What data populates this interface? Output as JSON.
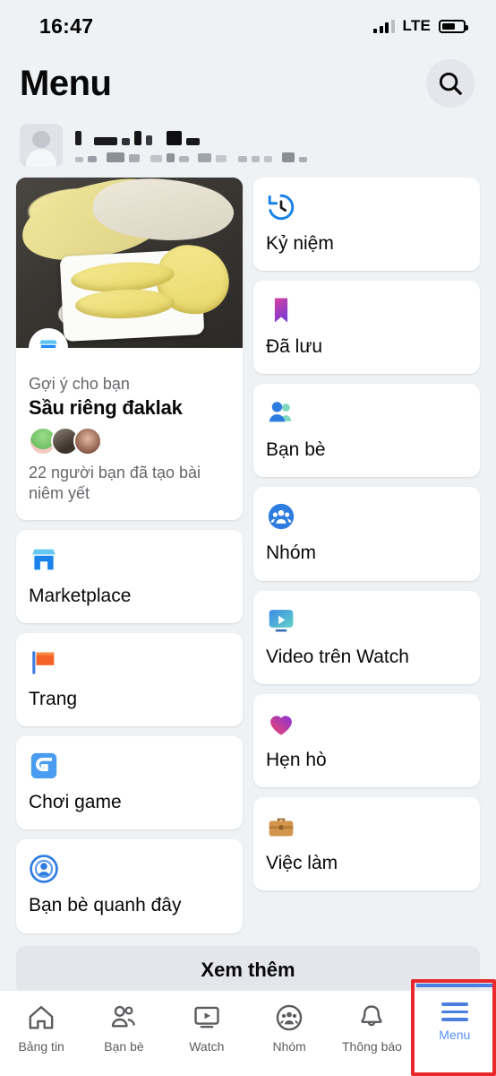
{
  "status_bar": {
    "time": "16:47",
    "network": "LTE",
    "signal_icon": "signal-bars-icon",
    "battery_icon": "battery-icon"
  },
  "header": {
    "title": "Menu",
    "search_icon": "search-icon"
  },
  "profile": {
    "avatar_icon": "user-avatar-placeholder",
    "name_redacted": true
  },
  "featured_card": {
    "badge_icon": "marketplace-store-icon",
    "suggestion_label": "Gợi ý cho bạn",
    "title": "Sầu riêng đaklak",
    "meta": "22 người bạn đã tạo bài niêm yết",
    "image_alt": "durian-photo"
  },
  "left_column": [
    {
      "label": "Marketplace",
      "icon": "marketplace-store-icon"
    },
    {
      "label": "Trang",
      "icon": "pages-flag-icon"
    },
    {
      "label": "Chơi game",
      "icon": "gaming-controller-icon"
    },
    {
      "label": "Bạn bè quanh đây",
      "icon": "nearby-friends-radar-icon"
    }
  ],
  "right_column": [
    {
      "label": "Kỷ niệm",
      "icon": "memories-clock-icon"
    },
    {
      "label": "Đã lưu",
      "icon": "saved-bookmark-icon"
    },
    {
      "label": "Bạn bè",
      "icon": "friends-people-icon"
    },
    {
      "label": "Nhóm",
      "icon": "groups-icon"
    },
    {
      "label": "Video trên Watch",
      "icon": "watch-video-icon"
    },
    {
      "label": "Hẹn hò",
      "icon": "dating-heart-icon"
    },
    {
      "label": "Việc làm",
      "icon": "jobs-briefcase-icon"
    }
  ],
  "see_more": {
    "label": "Xem thêm"
  },
  "bottom_nav": {
    "active_index": 5,
    "items": [
      {
        "label": "Bảng tin",
        "icon": "home-icon"
      },
      {
        "label": "Bạn bè",
        "icon": "friends-icon"
      },
      {
        "label": "Watch",
        "icon": "watch-icon"
      },
      {
        "label": "Nhóm",
        "icon": "groups-icon"
      },
      {
        "label": "Thông báo",
        "icon": "bell-notification-icon"
      },
      {
        "label": "Menu",
        "icon": "hamburger-menu-icon"
      }
    ]
  },
  "colors": {
    "background": "#eff2f5",
    "card": "#ffffff",
    "accent_blue": "#4a7fe0",
    "muted_text": "#65676b",
    "highlight_red": "#e8282b",
    "button_grey": "#e4e6eb"
  }
}
